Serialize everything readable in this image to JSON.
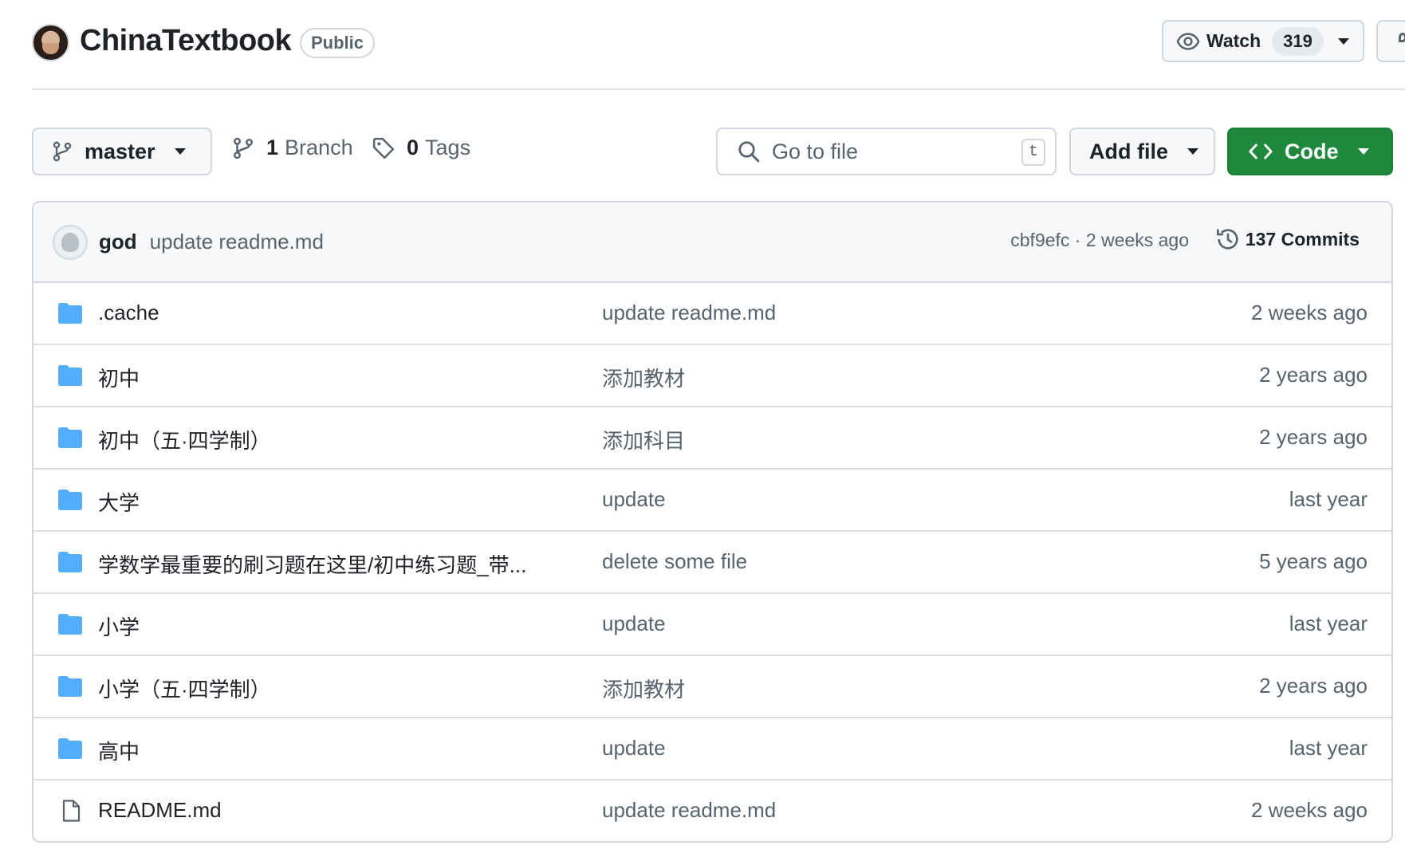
{
  "repo": {
    "name": "ChinaTextbook",
    "visibility": "Public"
  },
  "watch": {
    "label": "Watch",
    "count": "319"
  },
  "toolbar": {
    "branch": "master",
    "branches_count": "1",
    "branches_label": "Branch",
    "tags_count": "0",
    "tags_label": "Tags",
    "search_placeholder": "Go to file",
    "search_shortcut": "t",
    "add_file_label": "Add file",
    "code_label": "Code"
  },
  "latest_commit": {
    "author": "god",
    "message": "update readme.md",
    "meta": "cbf9efc · 2 weeks ago",
    "commits_label": "137 Commits"
  },
  "files": [
    {
      "type": "folder",
      "name": ".cache",
      "message": "update readme.md",
      "date": "2 weeks ago"
    },
    {
      "type": "folder",
      "name": "初中",
      "message": "添加教材",
      "date": "2 years ago"
    },
    {
      "type": "folder",
      "name": "初中（五·四学制）",
      "message": "添加科目",
      "date": "2 years ago"
    },
    {
      "type": "folder",
      "name": "大学",
      "message": "update",
      "date": "last year"
    },
    {
      "type": "folder",
      "name": "学数学最重要的刷习题在这里/初中练习题_带...",
      "message": "delete some file",
      "date": "5 years ago"
    },
    {
      "type": "folder",
      "name": "小学",
      "message": "update",
      "date": "last year"
    },
    {
      "type": "folder",
      "name": "小学（五·四学制）",
      "message": "添加教材",
      "date": "2 years ago"
    },
    {
      "type": "folder",
      "name": "高中",
      "message": "update",
      "date": "last year"
    },
    {
      "type": "file",
      "name": "README.md",
      "message": "update readme.md",
      "date": "2 weeks ago"
    }
  ],
  "colors": {
    "primary_green": "#1f883d",
    "folder_blue": "#54aeff",
    "border": "#d0d7de",
    "muted_text": "#59636e"
  },
  "icons": [
    "eye-icon",
    "git-branch-icon",
    "tag-icon",
    "search-icon",
    "code-icon",
    "history-icon",
    "folder-icon",
    "file-icon",
    "pin-icon"
  ]
}
